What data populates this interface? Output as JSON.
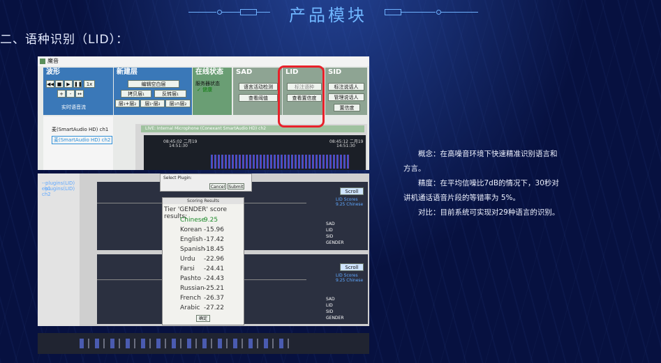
{
  "header": {
    "title": "产品模块",
    "section": "二、语种识别（LID）："
  },
  "app": {
    "window_title": "魔音",
    "toolbar": {
      "waveform": {
        "label": "波形",
        "play_controls": [
          "◀◀",
          "■",
          "▶",
          "❚❚"
        ],
        "speed": "1x",
        "realtime": "实时语音流"
      },
      "new_layer": {
        "label": "新建层",
        "buttons": [
          "编辑空白层",
          "拷贝层₁",
          "反转层₁",
          "层₁+层₂",
          "层₁-层₂",
          "层₁∩层₂"
        ]
      },
      "online": {
        "label": "在线状态",
        "status_label": "服务器状态",
        "status_value": "✓ 健康"
      },
      "sad": {
        "label": "SAD",
        "buttons": [
          "语言活动检测",
          "查看阈值"
        ]
      },
      "lid": {
        "label": "LID",
        "buttons": [
          "标注语种",
          "查看置信度"
        ]
      },
      "sid": {
        "label": "SID",
        "buttons": [
          "标注说话人",
          "管理说话人",
          "置信度"
        ]
      }
    },
    "channels": [
      "麦(SmartAudio HD) ch1",
      "麦(SmartAudio HD) ch2"
    ],
    "live_label": "LIVE: Internal Microphone (Conexant SmartAudio HD) ch2",
    "times": [
      "08:45:02 二月19",
      "14:51:30",
      "08:45:12 二月19",
      "14:51:30"
    ]
  },
  "scoring": {
    "dialog_title": "Scoring Results",
    "select_plugin": "Select Plugin:",
    "cancel": "Cancel",
    "submit": "Submit",
    "heading": "Tier 'GENDER' score results:",
    "rows": [
      {
        "lang": "Chinese",
        "score": "9.25"
      },
      {
        "lang": "Korean",
        "score": "-15.96"
      },
      {
        "lang": "English",
        "score": "-17.42"
      },
      {
        "lang": "Spanish",
        "score": "-18.45"
      },
      {
        "lang": "Urdu",
        "score": "-22.96"
      },
      {
        "lang": "Farsi",
        "score": "-24.41"
      },
      {
        "lang": "Pashto",
        "score": "-24.43"
      },
      {
        "lang": "Russian",
        "score": "-25.21"
      },
      {
        "lang": "French",
        "score": "-26.37"
      },
      {
        "lang": "Arabic",
        "score": "-27.22"
      }
    ],
    "ok": "确定"
  },
  "side_panels": [
    {
      "scroll": "Scroll",
      "lid_scores": "LID Scores",
      "lid_value": "9.25 Chinese",
      "tiers": [
        "SAD",
        "LID",
        "SID",
        "GENDER"
      ]
    },
    {
      "scroll": "Scroll",
      "lid_scores": "LID Scores",
      "lid_value": "9.25 Chinese",
      "tiers": [
        "SAD",
        "LID",
        "SID",
        "GENDER"
      ]
    }
  ],
  "description": {
    "concept_label": "概念：",
    "concept_text": "在高噪音环境下快速精准识别语言和方言。",
    "accuracy_label": "精度：",
    "accuracy_text": "在平均信噪比7dB的情况下，30秒对讲机通话语音片段的等错率为 5%。",
    "compare_label": "对比：",
    "compare_text": "目前系统可实现对29种语言的识别。"
  },
  "colors": {
    "title": "#6fb6ff",
    "background": "#071140",
    "highlight": "#e8212a"
  }
}
